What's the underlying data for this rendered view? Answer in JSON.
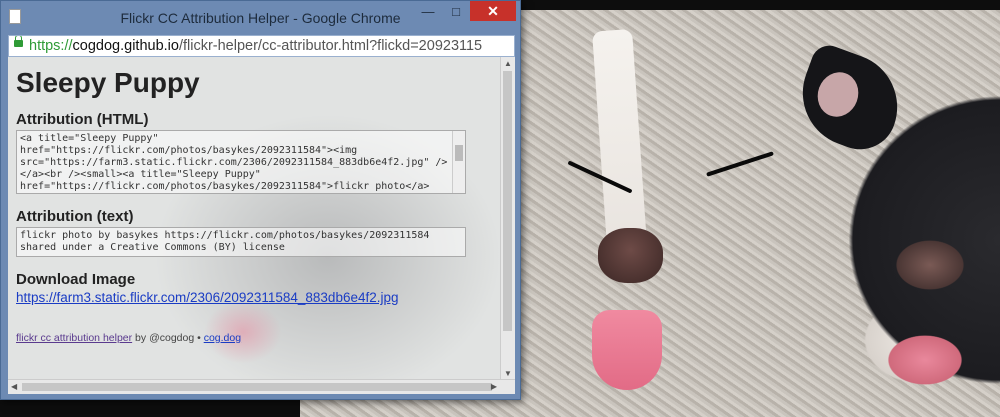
{
  "window": {
    "title": "Flickr CC Attribution Helper - Google Chrome",
    "minimize_glyph": "—",
    "maximize_glyph": "□",
    "close_glyph": "✕"
  },
  "address_bar": {
    "scheme": "https://",
    "host": "cogdog.github.io",
    "path": "/flickr-helper/cc-attributor.html?flickd=20923115"
  },
  "page": {
    "title": "Sleepy Puppy",
    "html_label": "Attribution (HTML)",
    "html_code": "<a title=\"Sleepy Puppy\" href=\"https://flickr.com/photos/basykes/2092311584\"><img src=\"https://farm3.static.flickr.com/2306/2092311584_883db6e4f2.jpg\" /></a><br /><small><a title=\"Sleepy Puppy\" href=\"https://flickr.com/photos/basykes/2092311584\">flickr photo</a>",
    "text_label": "Attribution (text)",
    "text_code": "flickr photo by basykes https://flickr.com/photos/basykes/2092311584 shared under a Creative Commons (BY) license",
    "download_label": "Download Image",
    "download_url": "https://farm3.static.flickr.com/2306/2092311584_883db6e4f2.jpg",
    "footer": {
      "link1": "flickr cc attribution helper",
      "by": " by @cogdog • ",
      "link2": "cog.dog"
    }
  }
}
